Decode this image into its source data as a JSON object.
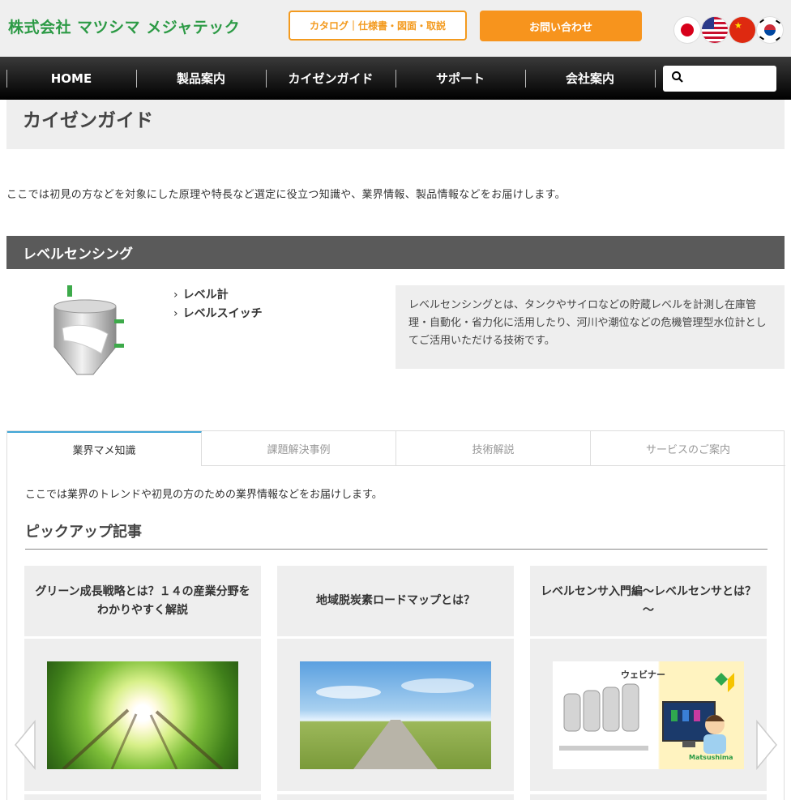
{
  "header": {
    "logo": "株式会社 マツシマ メジャテック",
    "catalog_button": "カタログ｜仕様書・図面・取説",
    "contact_button": "お問い合わせ"
  },
  "nav": {
    "items": [
      "HOME",
      "製品案内",
      "カイゼンガイド",
      "サポート",
      "会社案内"
    ],
    "search_placeholder": ""
  },
  "page": {
    "title": "カイゼンガイド",
    "intro": "ここでは初見の方などを対象にした原理や特長など選定に役立つ知識や、業界情報、製品情報などをお届けします。"
  },
  "section": {
    "title": "レベルセンシング",
    "links": [
      "レベル計",
      "レベルスイッチ"
    ],
    "description": "レベルセンシングとは、タンクやサイロなどの貯蔵レベルを計測し在庫管理・自動化・省力化に活用したり、河川や潮位などの危機管理型水位計としてご活用いただける技術です。"
  },
  "tabs": {
    "items": [
      "業界マメ知識",
      "課題解決事例",
      "技術解説",
      "サービスのご案内"
    ],
    "active": 0,
    "intro": "ここでは業界のトレンドや初見の方のための業界情報などをお届けします。",
    "pickup_heading": "ピックアップ記事"
  },
  "cards": [
    {
      "title": "グリーン成長戦略とは？１４の産業分野をわかりやすく解説"
    },
    {
      "title": "地域脱炭素ロードマップとは？"
    },
    {
      "title": "レベルセンサ入門編～レベルセンサとは？～",
      "image_label": "ウェビナー",
      "image_brand": "Matsushima"
    }
  ],
  "colors": {
    "brand_green": "#2c9a45",
    "accent_orange": "#f7941d",
    "tab_active": "#3fa5d6"
  }
}
